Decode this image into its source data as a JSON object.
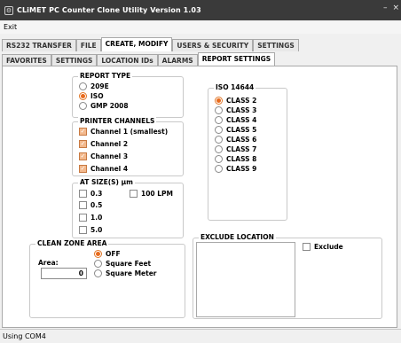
{
  "window": {
    "title": "CLiMET PC Counter Clone Utility  Version 1.03",
    "minimize": "–",
    "close": "×"
  },
  "menu": {
    "exit": "Exit"
  },
  "tabs_main": [
    {
      "label": "RS232 TRANSFER",
      "active": false
    },
    {
      "label": "FILE",
      "active": false
    },
    {
      "label": "CREATE, MODIFY",
      "active": true
    },
    {
      "label": "USERS & SECURITY",
      "active": false
    },
    {
      "label": "SETTINGS",
      "active": false
    }
  ],
  "tabs_sub": [
    {
      "label": "FAVORITES",
      "active": false
    },
    {
      "label": "SETTINGS",
      "active": false
    },
    {
      "label": "LOCATION IDs",
      "active": false
    },
    {
      "label": "ALARMS",
      "active": false
    },
    {
      "label": "REPORT SETTINGS",
      "active": true
    }
  ],
  "report_type": {
    "legend": "REPORT TYPE",
    "options": [
      {
        "label": "209E",
        "selected": false
      },
      {
        "label": "ISO",
        "selected": true
      },
      {
        "label": "GMP 2008",
        "selected": false
      }
    ]
  },
  "printer_channels": {
    "legend": "PRINTER CHANNELS",
    "items": [
      {
        "label": "Channel 1 (smallest)",
        "checked": true
      },
      {
        "label": "Channel 2",
        "checked": true
      },
      {
        "label": "Channel 3",
        "checked": true
      },
      {
        "label": "Channel 4",
        "checked": true
      }
    ]
  },
  "at_sizes": {
    "legend": "AT SIZE(S) μm",
    "items": [
      {
        "label": "0.3",
        "checked": false
      },
      {
        "label": "0.5",
        "checked": false
      },
      {
        "label": "1.0",
        "checked": false
      },
      {
        "label": "5.0",
        "checked": false
      }
    ],
    "lpm": {
      "label": "100 LPM",
      "checked": false
    }
  },
  "clean_zone": {
    "legend": "CLEAN ZONE AREA",
    "area_label": "Area:",
    "area_value": "0",
    "units": [
      {
        "label": "OFF",
        "selected": true
      },
      {
        "label": "Square Feet",
        "selected": false
      },
      {
        "label": "Square Meter",
        "selected": false
      }
    ]
  },
  "iso_14644": {
    "legend": "ISO 14644",
    "classes": [
      {
        "label": "CLASS 2",
        "selected": true
      },
      {
        "label": "CLASS 3",
        "selected": false
      },
      {
        "label": "CLASS 4",
        "selected": false
      },
      {
        "label": "CLASS 5",
        "selected": false
      },
      {
        "label": "CLASS 6",
        "selected": false
      },
      {
        "label": "CLASS 7",
        "selected": false
      },
      {
        "label": "CLASS 8",
        "selected": false
      },
      {
        "label": "CLASS 9",
        "selected": false
      }
    ]
  },
  "exclude_location": {
    "legend": "EXCLUDE LOCATION",
    "checkbox_label": "Exclude",
    "checked": false
  },
  "status": {
    "text": "Using COM4"
  },
  "colors": {
    "titlebar": "#3a3a3a",
    "radio_selected": "#e86a1c",
    "check_selected": "#f3b98d"
  }
}
